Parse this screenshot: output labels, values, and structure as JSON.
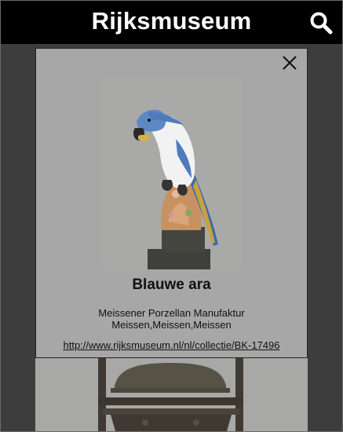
{
  "header": {
    "title": "Rijksmuseum",
    "search_icon": "search-icon"
  },
  "modal": {
    "close_icon": "close-icon",
    "artwork": {
      "title": "Blauwe ara",
      "maker_line1": "Meissener Porzellan Manufaktur",
      "maker_line2": "Meissen,Meissen,Meissen",
      "link": "http://www.rijksmuseum.nl/nl/collectie/BK-17496"
    }
  },
  "colors": {
    "header_bg": "#000000",
    "page_bg": "#3d3d3d",
    "modal_bg": "#a7a7a7"
  }
}
